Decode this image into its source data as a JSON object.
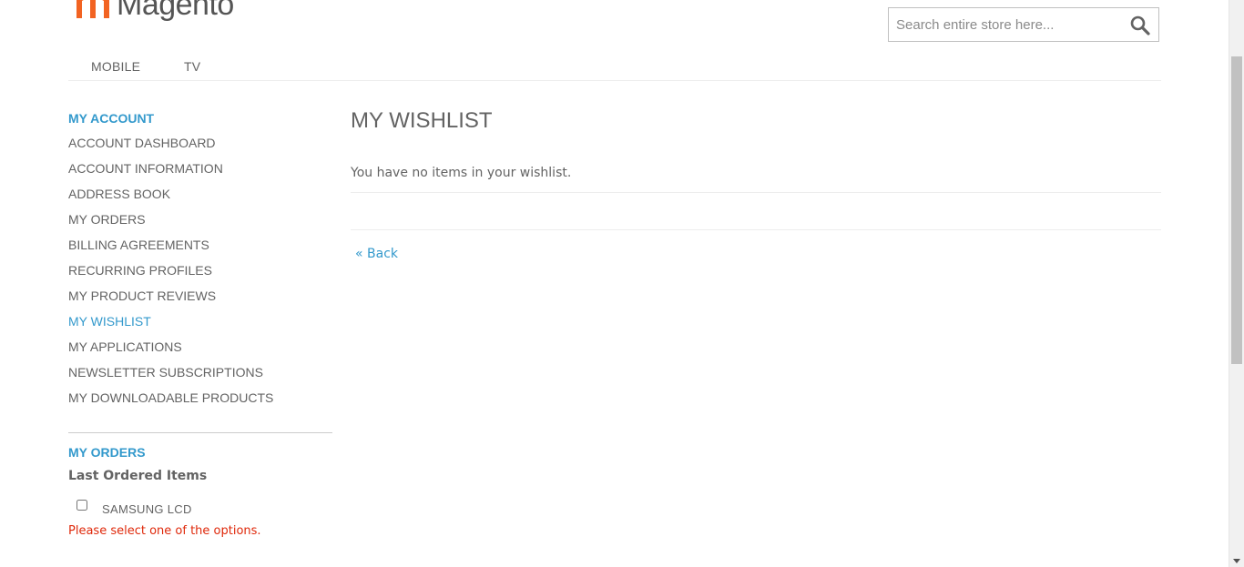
{
  "header": {
    "logo_text": "Magento",
    "search": {
      "placeholder": "Search entire store here..."
    }
  },
  "nav": {
    "items": [
      {
        "label": "MOBILE"
      },
      {
        "label": "TV"
      }
    ]
  },
  "sidebar": {
    "account_title": "MY ACCOUNT",
    "items": [
      {
        "label": "ACCOUNT DASHBOARD"
      },
      {
        "label": "ACCOUNT INFORMATION"
      },
      {
        "label": "ADDRESS BOOK"
      },
      {
        "label": "MY ORDERS"
      },
      {
        "label": "BILLING AGREEMENTS"
      },
      {
        "label": "RECURRING PROFILES"
      },
      {
        "label": "MY PRODUCT REVIEWS"
      },
      {
        "label": "MY WISHLIST",
        "current": true
      },
      {
        "label": "MY APPLICATIONS"
      },
      {
        "label": "NEWSLETTER SUBSCRIPTIONS"
      },
      {
        "label": "MY DOWNLOADABLE PRODUCTS"
      }
    ],
    "orders_block": {
      "title": "MY ORDERS",
      "subtitle": "Last Ordered Items",
      "items": [
        {
          "name": "SAMSUNG LCD",
          "checked": false
        }
      ],
      "validation_message": "Please select one of the options."
    }
  },
  "main": {
    "title": "MY WISHLIST",
    "empty_message": "You have no items in your wishlist.",
    "back_link": "« Back"
  },
  "colors": {
    "accent": "#3399cc",
    "text": "#636363",
    "error": "#df280a",
    "logo_orange": "#f26322"
  }
}
